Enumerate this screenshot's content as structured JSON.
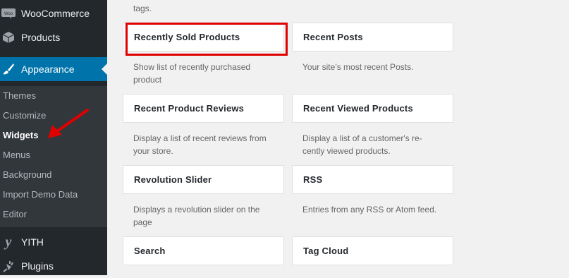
{
  "sidebar": {
    "woocommerce": {
      "label": "WooCommerce",
      "icon": "woocommerce-icon"
    },
    "products": {
      "label": "Products",
      "icon": "products-box-icon"
    },
    "appearance": {
      "label": "Appearance",
      "icon": "paintbrush-icon"
    },
    "submenu": [
      "Themes",
      "Customize",
      "Widgets",
      "Menus",
      "Background",
      "Import Demo Data",
      "Editor"
    ],
    "current_submenu": "Widgets",
    "yith": {
      "label": "YITH",
      "icon": "yith-icon"
    },
    "plugins": {
      "label": "Plugins",
      "icon": "plugin-icon"
    }
  },
  "widgets": {
    "top_desc": "tags.",
    "items": [
      {
        "title": "Recently Sold Products",
        "desc": "Show list of recently purchased product"
      },
      {
        "title": "Recent Posts",
        "desc": "Your site’s most recent Posts."
      },
      {
        "title": "Recent Product Reviews",
        "desc": "Display a list of recent reviews from your store."
      },
      {
        "title": "Recent Viewed Products",
        "desc": "Display a list of a customer's re-cently viewed products."
      },
      {
        "title": "Revolution Slider",
        "desc": "Displays a revolution slider on the page"
      },
      {
        "title": "RSS",
        "desc": "Entries from any RSS or Atom feed."
      },
      {
        "title": "Search",
        "desc": ""
      },
      {
        "title": "Tag Cloud",
        "desc": ""
      }
    ]
  },
  "annotation": {
    "highlight_color": "#e00000",
    "arrow_color": "#e00000"
  },
  "colors": {
    "sidebar_bg": "#23282d",
    "accent": "#0073aa"
  }
}
